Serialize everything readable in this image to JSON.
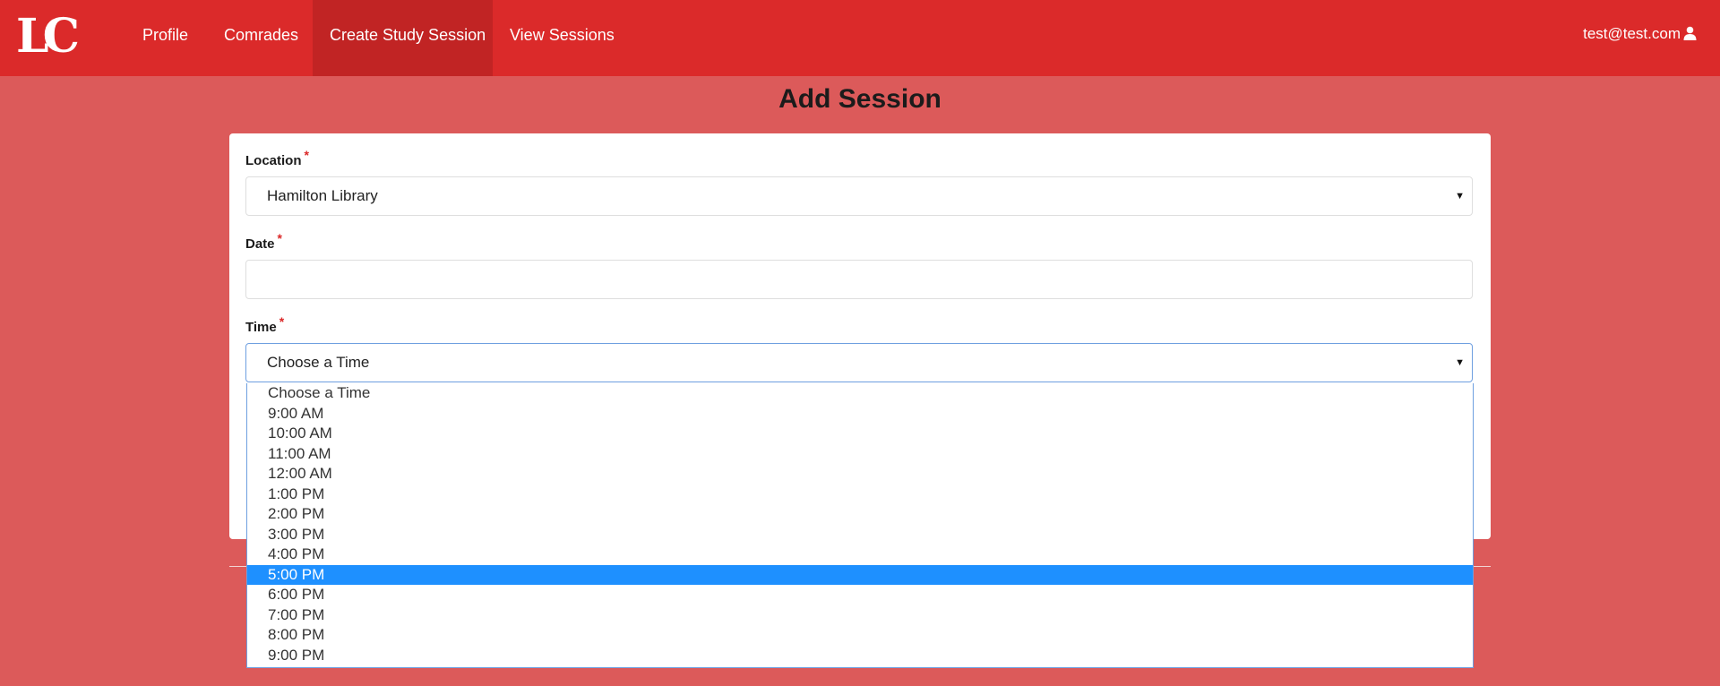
{
  "brand": {
    "logo": "LC"
  },
  "nav": {
    "items": [
      {
        "label": "Profile"
      },
      {
        "label": "Comrades"
      },
      {
        "label": "Create Study Session"
      },
      {
        "label": "View Sessions"
      }
    ],
    "active": "Create Study Session",
    "user": "test@test.com",
    "user_icon": "user-icon"
  },
  "page": {
    "title": "Add Session"
  },
  "form": {
    "required_marker": "*",
    "location": {
      "label": "Location",
      "value": "Hamilton Library"
    },
    "date": {
      "label": "Date",
      "value": ""
    },
    "time": {
      "label": "Time",
      "value": "Choose a Time",
      "highlighted_option": "5:00 PM",
      "options": [
        "Choose a Time",
        "9:00 AM",
        "10:00 AM",
        "11:00 AM",
        "12:00 AM",
        "1:00 PM",
        "2:00 PM",
        "3:00 PM",
        "4:00 PM",
        "5:00 PM",
        "6:00 PM",
        "7:00 PM",
        "8:00 PM",
        "9:00 PM"
      ]
    }
  },
  "colors": {
    "background": "#dc5a5a",
    "navbar": "#db2a2a",
    "nav_active": "#c12424",
    "required": "#db2828",
    "highlight": "#1e90ff"
  }
}
